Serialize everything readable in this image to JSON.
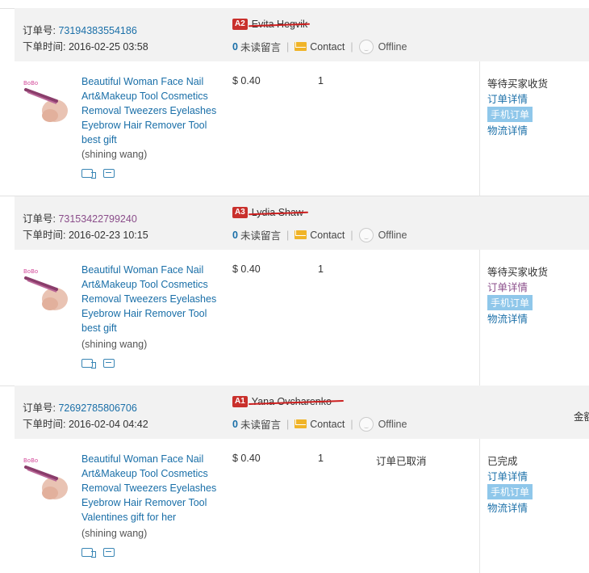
{
  "orders": [
    {
      "order_no_label": "订单号: ",
      "order_no": "73194383554186",
      "order_time_label": "下单时间: ",
      "order_time": "2016-02-25 03:58",
      "buyer_badge": "A2",
      "buyer_name": "Evita Hegvik",
      "unread_count": "0",
      "unread_label": "未读留言",
      "contact_label": "Contact",
      "offline_label": "Offline",
      "product_title": "Beautiful Woman Face Nail Art&Makeup Tool Cosmetics Removal Tweezers Eyelashes Eyebrow Hair Remover Tool best gift",
      "seller": "(shining wang)",
      "price": "$ 0.40",
      "quantity": "1",
      "item_status": "",
      "order_status": "等待买家收货",
      "detail_link": "订单详情",
      "mobile_badge": "手机订单",
      "logistics_link": "物流详情"
    },
    {
      "order_no_label": "订单号: ",
      "order_no": "73153422799240",
      "order_time_label": "下单时间: ",
      "order_time": "2016-02-23 10:15",
      "buyer_badge": "A3",
      "buyer_name": "Lydia Shaw",
      "unread_count": "0",
      "unread_label": "未读留言",
      "contact_label": "Contact",
      "offline_label": "Offline",
      "product_title": "Beautiful Woman Face Nail Art&Makeup Tool Cosmetics Removal Tweezers Eyelashes Eyebrow Hair Remover Tool best gift",
      "seller": "(shining wang)",
      "price": "$ 0.40",
      "quantity": "1",
      "item_status": "",
      "order_status": "等待买家收货",
      "detail_link": "订单详情",
      "mobile_badge": "手机订单",
      "logistics_link": "物流详情"
    },
    {
      "order_no_label": "订单号: ",
      "order_no": "72692785806706",
      "order_time_label": "下单时间: ",
      "order_time": "2016-02-04 04:42",
      "buyer_badge": "A1",
      "buyer_name": "Yana Ovcharenko",
      "unread_count": "0",
      "unread_label": "未读留言",
      "contact_label": "Contact",
      "offline_label": "Offline",
      "product_title": "Beautiful Woman Face Nail Art&Makeup Tool Cosmetics Removal Tweezers Eyelashes Eyebrow Hair Remover Tool Valentines gift for her",
      "seller": "(shining wang)",
      "price": "$ 0.40",
      "quantity": "1",
      "item_status": "订单已取消",
      "order_status": "已完成",
      "detail_link": "订单详情",
      "mobile_badge": "手机订单",
      "logistics_link": "物流详情",
      "clipped_amount_label": "金额"
    }
  ],
  "colors": {
    "link": "#1a6fa8",
    "visited_link": "#8a4d8a",
    "badge_red": "#c9302c",
    "header_bg": "#f2f2f2",
    "mobile_badge_bg": "#8fc7ea"
  }
}
